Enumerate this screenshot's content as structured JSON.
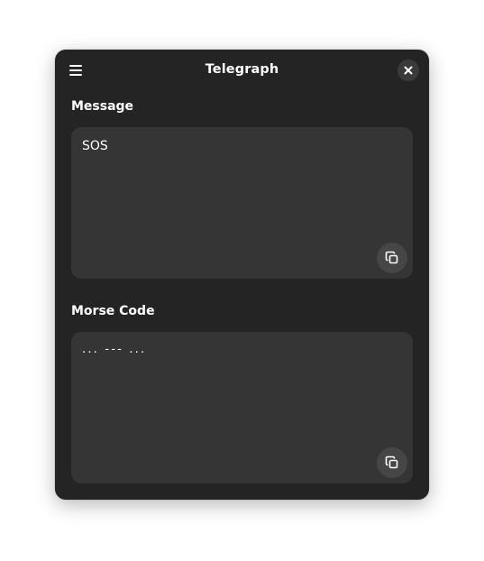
{
  "window": {
    "title": "Telegraph",
    "menu_icon": "hamburger-menu-icon",
    "close_icon": "close-icon"
  },
  "message": {
    "label": "Message",
    "text": "SOS",
    "copy_icon": "copy-icon"
  },
  "morse": {
    "label": "Morse Code",
    "text": "... --- ...",
    "copy_icon": "copy-icon"
  },
  "colors": {
    "window_bg": "#242424",
    "field_bg": "#353535",
    "button_bg": "#464646",
    "text": "#ffffff"
  }
}
